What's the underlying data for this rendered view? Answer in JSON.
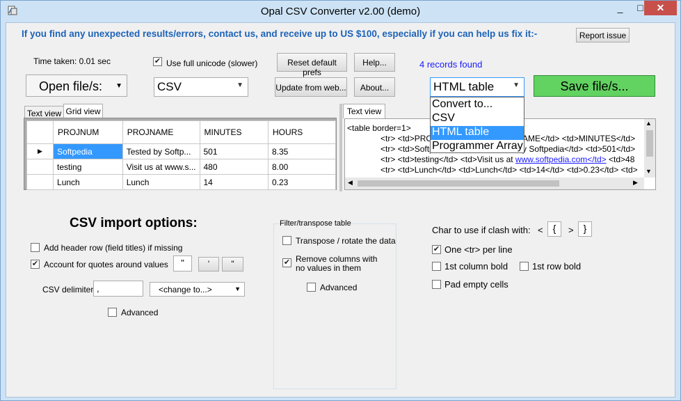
{
  "window": {
    "title": "Opal CSV Converter v2.00 (demo)",
    "min": "_",
    "max": "□",
    "close": "✕"
  },
  "banner": {
    "text": "If you find any unexpected results/errors, contact us, and receive up to US $100, especially if you can help us fix it:-",
    "report_button": "Report issue"
  },
  "top": {
    "time_taken": "Time taken: 0.01 sec",
    "full_unicode": {
      "label": "Use full unicode (slower)",
      "checked": true
    },
    "reset_button": "Reset default prefs",
    "help_button": "Help...",
    "records_found": "4 records found",
    "open_button": "Open file/s:",
    "format_combo": "CSV",
    "update_button": "Update from web...",
    "about_button": "About...",
    "output_combo": "HTML table",
    "save_button": "Save file/s..."
  },
  "dropdown": {
    "options": [
      "Convert to...",
      "CSV",
      "HTML table",
      "Programmer Array"
    ],
    "selected": "HTML table"
  },
  "left_tabs": {
    "text_view": "Text view",
    "grid_view": "Grid view"
  },
  "grid": {
    "columns": [
      "PROJNUM",
      "PROJNAME",
      "MINUTES",
      "HOURS"
    ],
    "rows": [
      [
        "Softpedia",
        "Tested by Softp...",
        "501",
        "8.35"
      ],
      [
        "testing",
        "Visit us at www.s...",
        "480",
        "8.00"
      ],
      [
        "Lunch",
        "Lunch",
        "14",
        "0.23"
      ]
    ],
    "row_marker": "▶"
  },
  "right_tab": {
    "text_view": "Text view"
  },
  "html_preview": {
    "line1": "<table border=1>",
    "line2a": "<tr>  <td>PRO",
    "line2b": "AME</td>  <td>MINUTES</td>",
    "line3a": "<tr>  <td>Softp",
    "line3b": "y Softpedia</td>  <td>501</td>",
    "line4a": "<tr>  <td>testing</td>  <td>Visit us at ",
    "line4link": "www.softpedia.com</td>",
    "line4b": "  <td>48",
    "line5": "<tr>  <td>Lunch</td>  <td>Lunch</td>  <td>14</td>  <td>0.23</td>  <td>"
  },
  "csv_import": {
    "heading": "CSV import options:",
    "add_header": {
      "label": "Add header row (field titles) if missing",
      "checked": false
    },
    "quotes": {
      "label": "Account for quotes around values",
      "checked": true
    },
    "quote_boxes": [
      "\"",
      "'",
      "\""
    ],
    "delimiter_label": "CSV delimiter",
    "delimiter_value": ",",
    "delimiter_combo": "<change to...>",
    "advanced": {
      "label": "Advanced",
      "checked": false
    }
  },
  "filter": {
    "title": "Filter/transpose table",
    "transpose": {
      "label": "Transpose / rotate the data",
      "checked": false
    },
    "remove_empty_1": "Remove columns with",
    "remove_empty_2": "no values in them",
    "remove_checked": true,
    "advanced": {
      "label": "Advanced",
      "checked": false
    }
  },
  "html_options": {
    "clash_label": "Char to use if clash with:",
    "lt": "<",
    "lt_value": "{",
    "gt": ">",
    "gt_value": "}",
    "one_tr": {
      "label": "One <tr> per line",
      "checked": true
    },
    "first_col_bold": {
      "label": "1st column bold",
      "checked": false
    },
    "first_row_bold": {
      "label": "1st row bold",
      "checked": false
    },
    "pad_empty": {
      "label": "Pad empty cells",
      "checked": false
    }
  },
  "icons": [
    "app-icon",
    "checkmark-icon",
    "chevron-down-icon",
    "row-pointer-icon",
    "scroll-arrow-icon"
  ],
  "colors": {
    "accent": "#3399ff",
    "banner": "#1d63b8",
    "save": "#62d261",
    "records": "#1a1aff",
    "close": "#c7504b"
  }
}
